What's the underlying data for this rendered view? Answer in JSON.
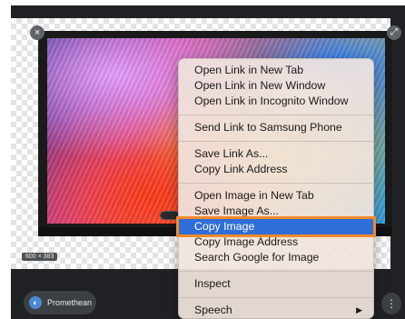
{
  "image_viewer": {
    "dimensions_badge": "600 × 383",
    "close_icon": "×",
    "expand_icon": "⤢",
    "source_label": "Promethean",
    "source_icon": "promethean-logo-icon",
    "more_icon": "⋮"
  },
  "context_menu": {
    "groups": [
      [
        "Open Link in New Tab",
        "Open Link in New Window",
        "Open Link in Incognito Window"
      ],
      [
        "Send Link to Samsung Phone"
      ],
      [
        "Save Link As...",
        "Copy Link Address"
      ],
      [
        "Open Image in New Tab",
        "Save Image As...",
        "Copy Image",
        "Copy Image Address",
        "Search Google for Image"
      ],
      [
        "Inspect"
      ],
      [
        "Speech"
      ]
    ],
    "highlighted": "Copy Image",
    "submenu_arrow": "▶",
    "highlight_color": "#2f6ed8",
    "focus_ring_color": "#f2892a"
  }
}
